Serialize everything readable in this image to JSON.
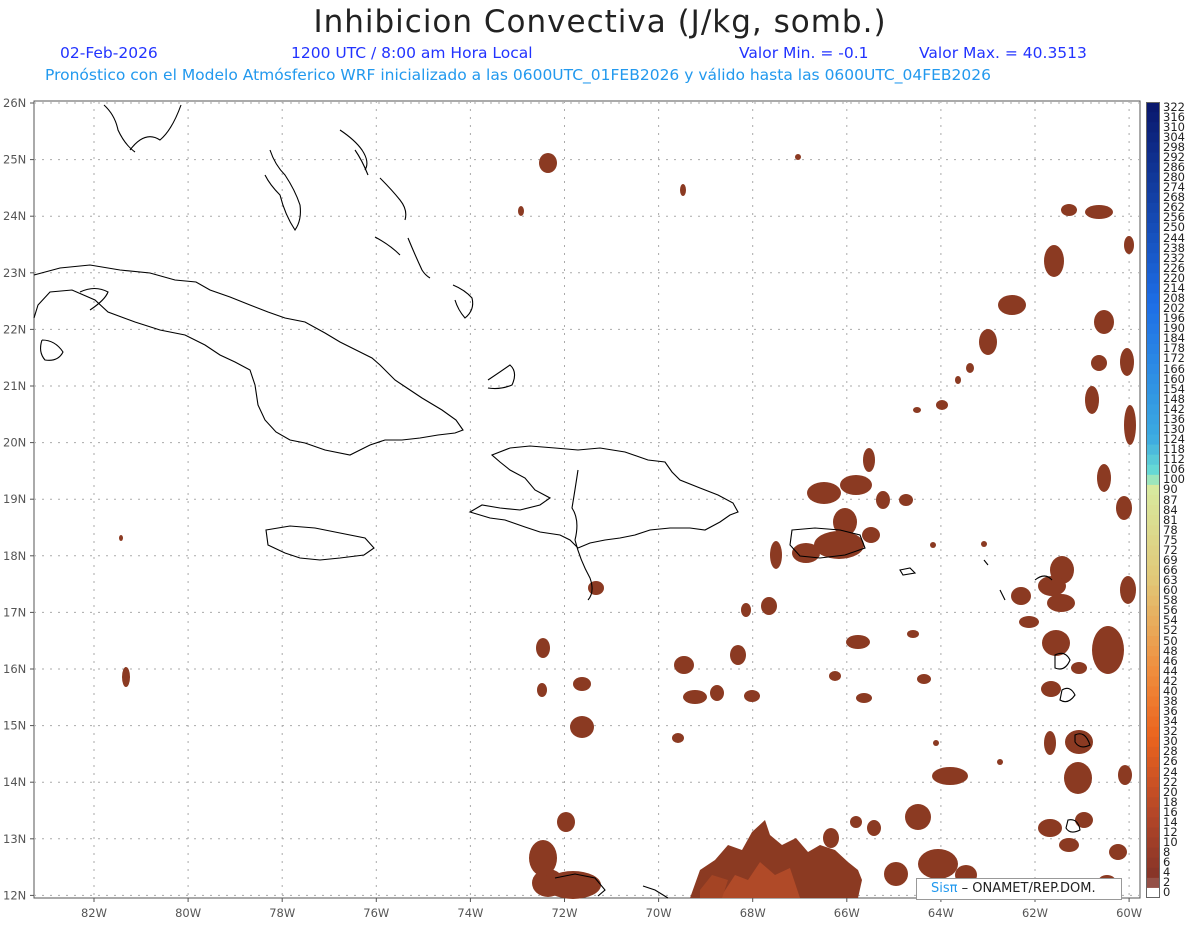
{
  "title": "Inhibicion Convectiva (J/kg, somb.)",
  "date": "02-Feb-2026",
  "time": "1200 UTC / 8:00 am Hora Local",
  "valor_min": "Valor Min. = -0.1",
  "valor_max": "Valor Max. = 40.3513",
  "model_info": "Pronóstico con el Modelo Atmósferico WRF inicializado a las 0600UTC_01FEB2026 y válido hasta las  0600UTC_04FEB2026",
  "lat_labels": [
    "26N",
    "25N",
    "24N",
    "23N",
    "22N",
    "21N",
    "20N",
    "19N",
    "18N",
    "17N",
    "16N",
    "15N",
    "14N",
    "13N",
    "12N"
  ],
  "lon_labels": [
    "82W",
    "80W",
    "78W",
    "76W",
    "74W",
    "72W",
    "70W",
    "68W",
    "66W",
    "64W",
    "62W",
    "60W"
  ],
  "colorbar_labels": [
    "322",
    "316",
    "310",
    "304",
    "298",
    "292",
    "286",
    "280",
    "274",
    "268",
    "262",
    "256",
    "250",
    "244",
    "238",
    "232",
    "226",
    "220",
    "214",
    "208",
    "202",
    "196",
    "190",
    "184",
    "178",
    "172",
    "166",
    "160",
    "154",
    "148",
    "142",
    "136",
    "130",
    "124",
    "118",
    "112",
    "106",
    "100",
    "90",
    "87",
    "84",
    "81",
    "78",
    "75",
    "72",
    "69",
    "66",
    "63",
    "60",
    "58",
    "56",
    "54",
    "52",
    "50",
    "48",
    "46",
    "44",
    "42",
    "40",
    "38",
    "36",
    "34",
    "32",
    "30",
    "28",
    "26",
    "24",
    "22",
    "20",
    "18",
    "16",
    "14",
    "12",
    "10",
    "8",
    "6",
    "4",
    "2",
    "0"
  ],
  "colors": {
    "cin_fill": "#8b3a22",
    "cin_fill_light": "#a84a26",
    "coast": "#000000",
    "grid": "#aaaaaa",
    "text_blue": "#2233ff",
    "text_cyan": "#2299ee"
  },
  "credit": {
    "sis": "Sisπ",
    "org": " – ONAMET/REP.DOM."
  }
}
